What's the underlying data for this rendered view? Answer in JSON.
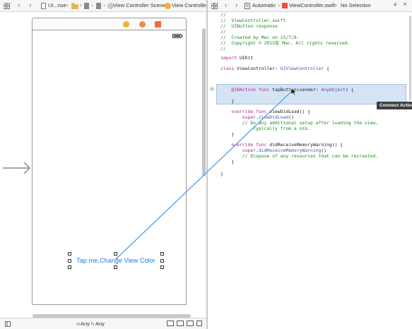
{
  "ib_jumpbar": {
    "crumbs": [
      "UI...nse",
      "View Controller Scene",
      "View Controller"
    ]
  },
  "editor_jumpbar": {
    "mode": "Automatic",
    "file": "ViewController.swift",
    "selection": "No Selection"
  },
  "canvas": {
    "button_title": "Tap me,Change View Color"
  },
  "size_class": {
    "width": "Any",
    "height": "Any"
  },
  "code": {
    "lines": [
      "//",
      "//  ViewController.swift",
      "//  UIButton-response",
      "//",
      "//  Created by Mac on 15/7/8.",
      "//  Copyright © 2015年 Mac. All rights reserved.",
      "//",
      "import UIKit",
      "class ViewController: UIViewController {",
      "    @IBAction func tapButton(sender: AnyObject) {",
      "    }",
      "    override func viewDidLoad() {",
      "        super.viewDidLoad()",
      "        // Do any additional setup after loading the view,",
      "            typically from a nib.",
      "    }",
      "    override func didReceiveMemoryWarning() {",
      "        super.didReceiveMemoryWarning()",
      "        // Dispose of any resources that can be recreated.",
      "    }",
      "}"
    ]
  },
  "tooltip": {
    "label": "Connect Action"
  },
  "icons": {
    "grid": "grid-icon",
    "back": "chevron-left-icon",
    "forward": "chevron-right-icon",
    "add": "plus-icon",
    "close": "close-icon"
  },
  "colors": {
    "connection_line": "#5aa6e8",
    "highlight": "#d4e4f5",
    "button_text": "#1c7de0",
    "comment": "#1b8a1b",
    "keyword": "#b3228f"
  }
}
